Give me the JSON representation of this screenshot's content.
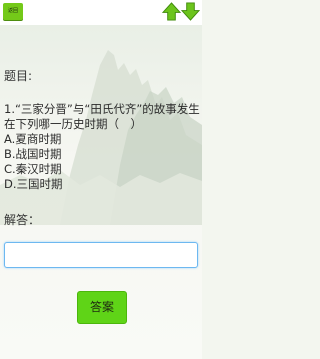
{
  "topbar": {
    "back_label": "返回",
    "prev_icon": "arrow-up-icon",
    "next_icon": "arrow-down-icon",
    "accent_color": "#74c919"
  },
  "question": {
    "label": "题目:",
    "stem": "1.“三家分晋”与“田氏代齐”的故事发生在下列哪一历史时期（　）",
    "options": [
      "A.夏商时期",
      "B.战国时期",
      "C.秦汉时期",
      "D.三国时期"
    ]
  },
  "answer": {
    "label": "解答：",
    "value": "",
    "placeholder": ""
  },
  "submit": {
    "label": "答案"
  }
}
